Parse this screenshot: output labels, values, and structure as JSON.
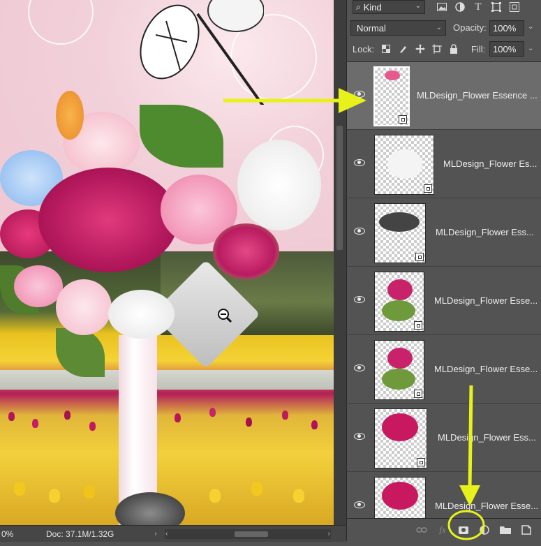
{
  "canvas": {
    "status": {
      "zoom": "0%",
      "doc_info": "Doc: 37.1M/1.32G",
      "arrow": "›",
      "scroll_left": "‹",
      "scroll_right": "›"
    }
  },
  "layers_panel": {
    "filter": {
      "label": "Kind",
      "search_icon": "⌕",
      "icons": [
        "image-filter-icon",
        "adjustment-filter-icon",
        "type-filter-icon",
        "shape-filter-icon",
        "smart-object-filter-icon"
      ]
    },
    "blend_mode": "Normal",
    "opacity_label": "Opacity:",
    "opacity_value": "100%",
    "lock_label": "Lock:",
    "lock_icons": [
      "lock-transparent-pixels-icon",
      "lock-image-pixels-icon",
      "lock-position-icon",
      "lock-artboard-icon",
      "lock-all-icon"
    ],
    "fill_label": "Fill:",
    "fill_value": "100%",
    "layers": [
      {
        "name": "MLDesign_Flower Essence ...",
        "selected": true,
        "visible": true,
        "content": "pink-flower-stem"
      },
      {
        "name": "MLDesign_Flower Es...",
        "selected": false,
        "visible": true,
        "content": "white-flower"
      },
      {
        "name": "MLDesign_Flower Ess...",
        "selected": false,
        "visible": true,
        "content": "dragonfly"
      },
      {
        "name": "MLDesign_Flower Esse...",
        "selected": false,
        "visible": true,
        "content": "pink-rosebud"
      },
      {
        "name": "MLDesign_Flower Esse...",
        "selected": false,
        "visible": true,
        "content": "pink-rosebud"
      },
      {
        "name": "MLDesign_Flower Ess...",
        "selected": false,
        "visible": true,
        "content": "magenta-peony"
      },
      {
        "name": "MLDesign_Flower Esse...",
        "selected": false,
        "visible": true,
        "content": "magenta-peony"
      }
    ],
    "bottom_bar": [
      "link-layers-icon",
      "fx-icon",
      "add-layer-mask-icon",
      "adjustment-layer-icon",
      "new-group-icon",
      "new-layer-icon"
    ]
  },
  "annotations": {
    "highlight_color": "#e6f21a"
  }
}
